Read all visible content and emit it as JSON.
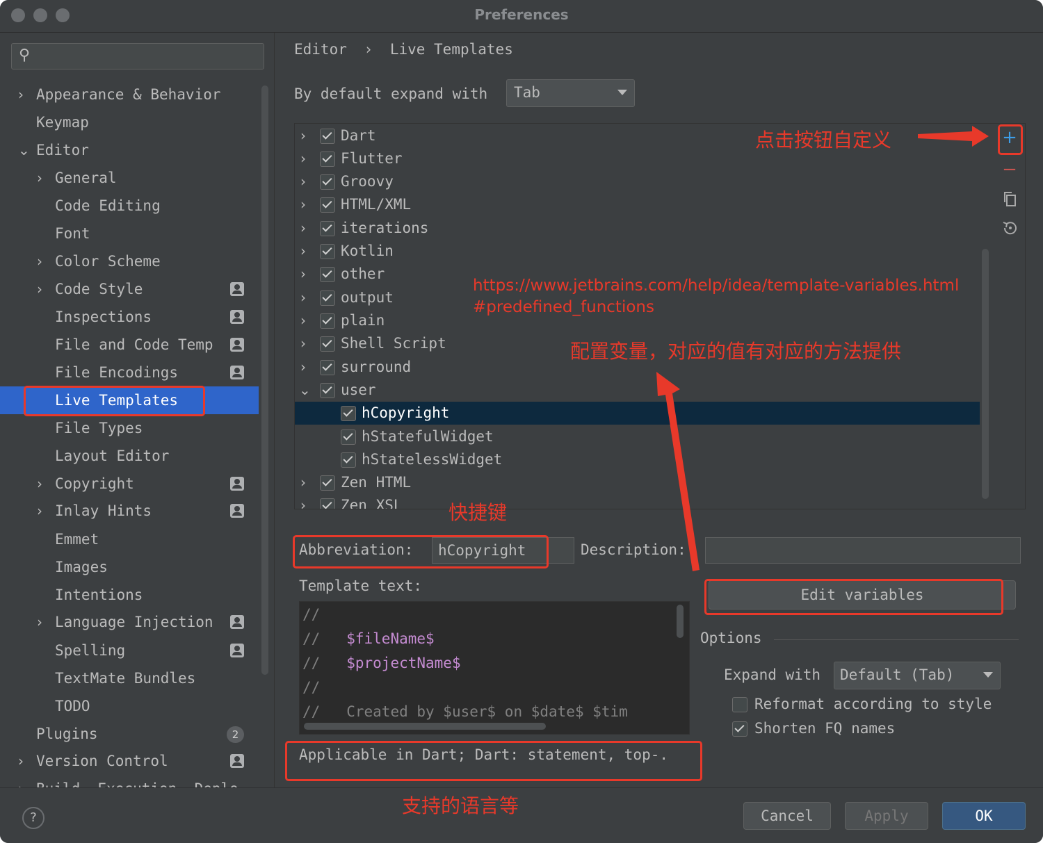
{
  "window": {
    "title": "Preferences"
  },
  "sidebar": {
    "items": [
      {
        "label": "Appearance & Behavior",
        "name": "appearance-behavior"
      },
      {
        "label": "Keymap",
        "name": "keymap"
      },
      {
        "label": "Editor",
        "name": "editor"
      },
      {
        "label": "General",
        "name": "general"
      },
      {
        "label": "Code Editing",
        "name": "code-editing"
      },
      {
        "label": "Font",
        "name": "font"
      },
      {
        "label": "Color Scheme",
        "name": "color-scheme"
      },
      {
        "label": "Code Style",
        "name": "code-style"
      },
      {
        "label": "Inspections",
        "name": "inspections"
      },
      {
        "label": "File and Code Temp",
        "name": "file-and-code-templates"
      },
      {
        "label": "File Encodings",
        "name": "file-encodings"
      },
      {
        "label": "Live Templates",
        "name": "live-templates"
      },
      {
        "label": "File Types",
        "name": "file-types"
      },
      {
        "label": "Layout Editor",
        "name": "layout-editor"
      },
      {
        "label": "Copyright",
        "name": "copyright"
      },
      {
        "label": "Inlay Hints",
        "name": "inlay-hints"
      },
      {
        "label": "Emmet",
        "name": "emmet"
      },
      {
        "label": "Images",
        "name": "images"
      },
      {
        "label": "Intentions",
        "name": "intentions"
      },
      {
        "label": "Language Injection",
        "name": "language-injections"
      },
      {
        "label": "Spelling",
        "name": "spelling"
      },
      {
        "label": "TextMate Bundles",
        "name": "textmate-bundles"
      },
      {
        "label": "TODO",
        "name": "todo"
      },
      {
        "label": "Plugins",
        "name": "plugins",
        "badge": "2"
      },
      {
        "label": "Version Control",
        "name": "version-control"
      },
      {
        "label": "Build, Execution, Deplo",
        "name": "build-execution-deployment"
      }
    ]
  },
  "breadcrumb": {
    "part1": "Editor",
    "sep": "›",
    "part2": "Live Templates"
  },
  "expand": {
    "label": "By default expand with",
    "value": "Tab"
  },
  "templates": [
    {
      "label": "Dart",
      "checked": true
    },
    {
      "label": "Flutter",
      "checked": true
    },
    {
      "label": "Groovy",
      "checked": true
    },
    {
      "label": "HTML/XML",
      "checked": true
    },
    {
      "label": "iterations",
      "checked": true
    },
    {
      "label": "Kotlin",
      "checked": true
    },
    {
      "label": "other",
      "checked": true
    },
    {
      "label": "output",
      "checked": true
    },
    {
      "label": "plain",
      "checked": true
    },
    {
      "label": "Shell Script",
      "checked": true
    },
    {
      "label": "surround",
      "checked": true
    },
    {
      "label": "user",
      "checked": true
    },
    {
      "label": "hCopyright",
      "checked": true
    },
    {
      "label": "hStatefulWidget",
      "checked": true
    },
    {
      "label": "hStatelessWidget",
      "checked": true
    },
    {
      "label": "Zen HTML",
      "checked": true
    },
    {
      "label": "Zen XSL",
      "checked": true
    }
  ],
  "toolbar": {
    "add": "+",
    "remove": "−"
  },
  "annotations": {
    "custom_button": "点击按钮自定义",
    "url_line1": "https://www.jetbrains.com/help/idea/template-variables.html",
    "url_line2": "#predefined_functions",
    "variables": "配置变量，对应的值有对应的方法提供",
    "shortcut": "快捷键",
    "languages": "支持的语言等"
  },
  "abbreviation": {
    "label": "Abbreviation:",
    "value": "hCopyright"
  },
  "description": {
    "label": "Description:",
    "value": ""
  },
  "template_text": {
    "label": "Template text:",
    "lines": [
      {
        "prefix": "//",
        "body": ""
      },
      {
        "prefix": "//",
        "body": "   $fileName$"
      },
      {
        "prefix": "//",
        "body": "   $projectName$"
      },
      {
        "prefix": "//",
        "body": ""
      },
      {
        "prefix": "//",
        "body": "   Created by $user$ on $date$ $tim"
      }
    ]
  },
  "edit_variables": "Edit variables",
  "options": {
    "title": "Options",
    "expand_label": "Expand with",
    "expand_value": "Default (Tab)",
    "reformat": "Reformat according to style",
    "shorten": "Shorten FQ names",
    "reformat_checked": false,
    "shorten_checked": true
  },
  "applicable": "Applicable in Dart; Dart: statement, top-.",
  "buttons": {
    "help": "?",
    "cancel": "Cancel",
    "apply": "Apply",
    "ok": "OK"
  },
  "colors": {
    "annotation": "#e8392a",
    "selection": "#2f65ca",
    "tree_selection": "#0d293e",
    "accent": "#365880"
  }
}
